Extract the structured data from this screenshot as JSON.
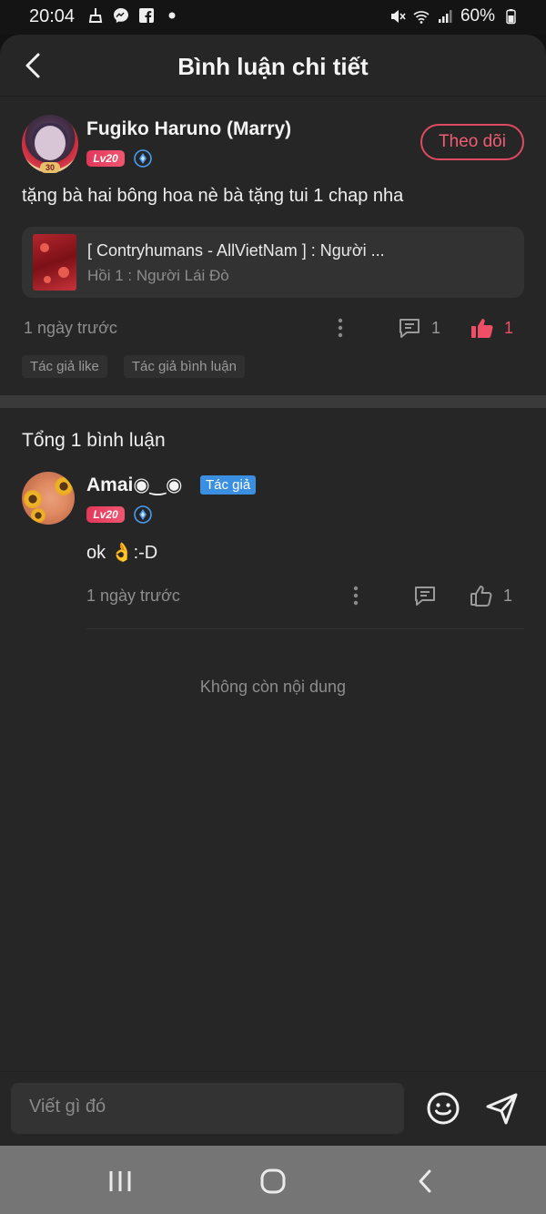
{
  "status_bar": {
    "time": "20:04",
    "battery": "60%",
    "icons": [
      "broom-icon",
      "messenger-icon",
      "facebook-icon",
      "dot-icon",
      "mute-icon",
      "wifi-icon",
      "signal-icon",
      "battery-icon"
    ]
  },
  "header": {
    "title": "Bình luận chi tiết",
    "back_icon": "chevron-left-icon"
  },
  "post": {
    "author": "Fugiko Haruno (Marry)",
    "level": "Lv20",
    "follow_label": "Theo dõi",
    "content": "tặng bà hai bông hoa nè bà tặng tui 1 chap nha",
    "link": {
      "title": "[ Contryhumans - AllVietNam ] : Người ...",
      "subtitle": "Hồi 1 : Người Lái Đò"
    },
    "time": "1 ngày trước",
    "comment_count": "1",
    "like_count": "1",
    "tags": [
      "Tác giả like",
      "Tác giả bình luận"
    ]
  },
  "comments": {
    "total_label": "Tổng 1 bình luận",
    "items": [
      {
        "author": "Amai◉‿◉",
        "author_badge": "Tác giả",
        "level": "Lv20",
        "text": "ok 👌:-D",
        "time": "1 ngày trước",
        "like_count": "1"
      }
    ],
    "end_label": "Không còn nội dung"
  },
  "composer": {
    "placeholder": "Viết gì đó"
  },
  "colors": {
    "accent": "#e04a61",
    "author_badge": "#3a8fe0",
    "background": "#262626",
    "card": "#323232"
  }
}
